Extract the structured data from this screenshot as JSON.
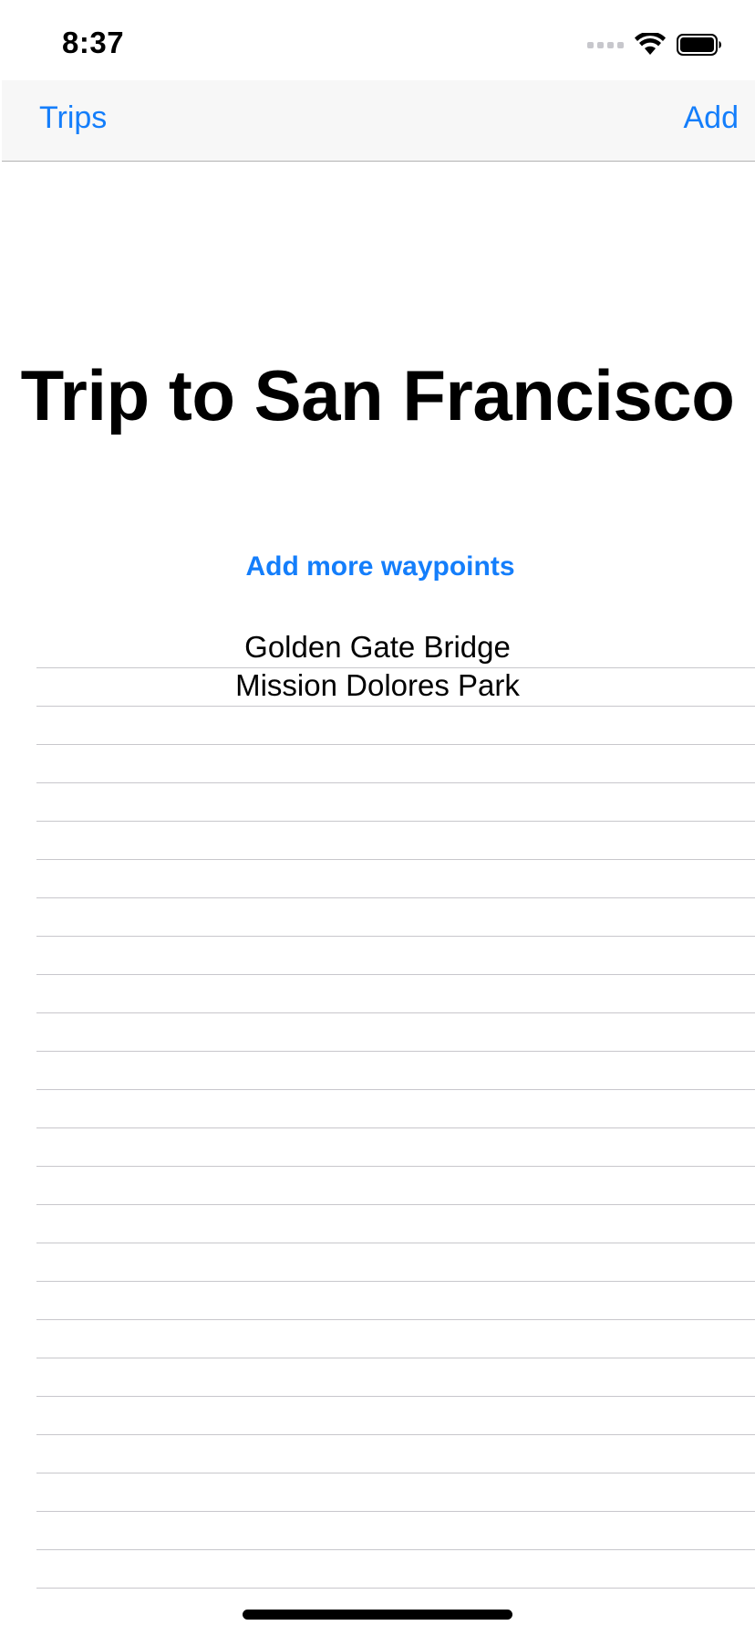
{
  "status_bar": {
    "time": "8:37",
    "icons": [
      "cellular-signal-icon",
      "wifi-icon",
      "battery-icon"
    ]
  },
  "nav": {
    "back_label": "Trips",
    "add_label": "Add"
  },
  "trip": {
    "title": "Trip to San Francisco",
    "add_waypoints_label": "Add more waypoints"
  },
  "waypoints": [
    "Golden Gate Bridge",
    "Mission Dolores Park"
  ],
  "colors": {
    "accent": "#147efb",
    "nav_background": "#f7f7f7",
    "separator": "#c8c7cc"
  }
}
